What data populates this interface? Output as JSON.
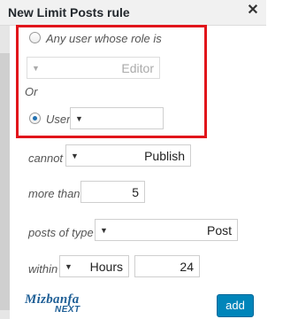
{
  "dialog": {
    "title": "New Limit Posts rule",
    "close_icon": "close-icon"
  },
  "role_option": {
    "label": "Any user whose role is",
    "selected": false,
    "select_value": "Editor",
    "disabled": true
  },
  "or_label": "Or",
  "user_option": {
    "label": "User",
    "selected": true,
    "select_value": ""
  },
  "cannot": {
    "label": "cannot",
    "value": "Publish"
  },
  "more_than": {
    "label": "more than",
    "value": "5"
  },
  "posts_of_type": {
    "label": "posts of type",
    "value": "Post"
  },
  "within": {
    "label": "within",
    "unit": "Hours",
    "value": "24"
  },
  "logo": {
    "line1": "Mizbanfa",
    "line2": "NEXT"
  },
  "add_button": {
    "label": "add",
    "color": "#0085ba"
  },
  "highlight_color": "#e1151b"
}
